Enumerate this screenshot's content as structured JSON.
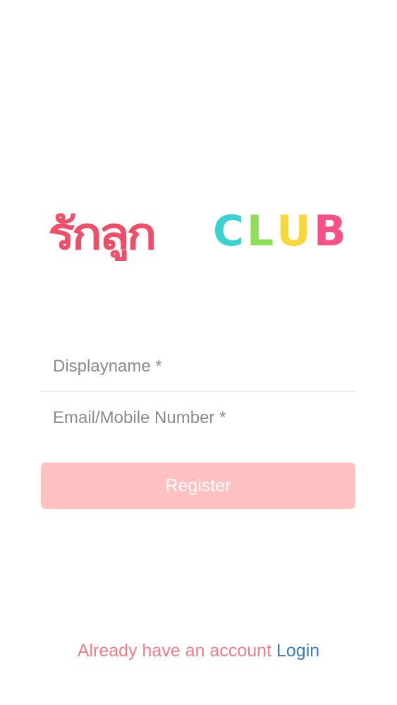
{
  "logo": {
    "thai_text": "รักลูก",
    "club_letters": [
      {
        "char": "C",
        "color": "#3bd3d0"
      },
      {
        "char": "L",
        "color": "#8ede57"
      },
      {
        "char": "U",
        "color": "#f6d83a"
      },
      {
        "char": "B",
        "color": "#f74f86"
      }
    ],
    "thai_color": "#ef4d68"
  },
  "form": {
    "displayname_placeholder": "Displayname *",
    "email_placeholder": "Email/Mobile Number *",
    "displayname_value": "",
    "email_value": ""
  },
  "register": {
    "label": "Register",
    "background": "#ffc1c1"
  },
  "footer": {
    "prompt": "Already have an account",
    "prompt_color": "#ef7d86",
    "login_label": "Login",
    "login_color": "#3b7bc0"
  }
}
